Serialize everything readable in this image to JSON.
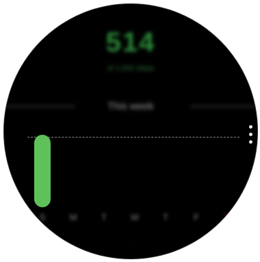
{
  "summary": {
    "value": "514",
    "caption": "of 1,000 steps"
  },
  "period": {
    "label": "This week"
  },
  "chart_data": {
    "type": "bar",
    "categories": [
      "S",
      "M",
      "T",
      "W",
      "T",
      "F",
      "S"
    ],
    "values": [
      514,
      0,
      0,
      0,
      0,
      0,
      0
    ],
    "target": 500,
    "ylim": [
      0,
      560
    ],
    "today_index": 6,
    "bar_color": "#5fc15a",
    "target_line": "dashed"
  },
  "menu": {
    "icon": "more-options-icon"
  },
  "colors": {
    "background": "#000000",
    "accent": "#5fc15a",
    "today": "#b5302e"
  }
}
